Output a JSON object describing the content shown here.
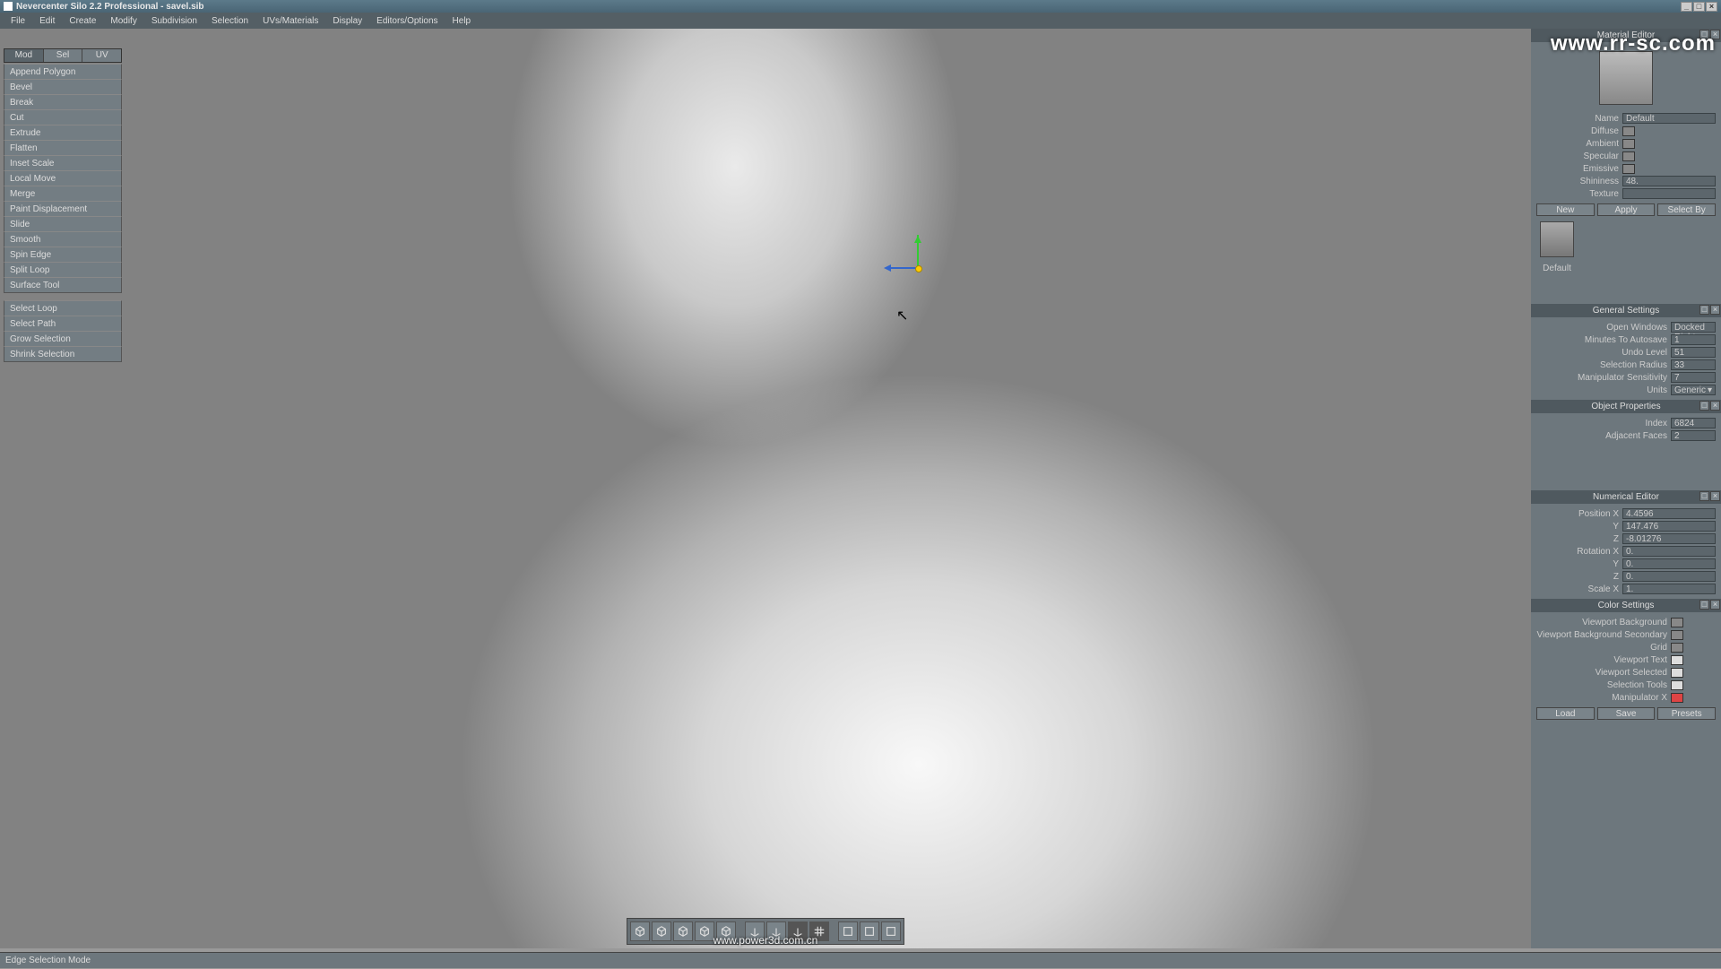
{
  "app": {
    "title": "Nevercenter Silo 2.2 Professional - savel.sib"
  },
  "menu": [
    "File",
    "Edit",
    "Create",
    "Modify",
    "Subdivision",
    "Selection",
    "UVs/Materials",
    "Display",
    "Editors/Options",
    "Help"
  ],
  "watermarkUrl": "www.rr-sc.com",
  "powerUrl": "www.power3d.com.cn",
  "segtabs": {
    "items": [
      "Mod",
      "Sel",
      "UV"
    ],
    "active": 0
  },
  "tools": {
    "groupA": [
      "Append Polygon",
      "Bevel",
      "Break",
      "Cut",
      "Extrude",
      "Flatten",
      "Inset Scale",
      "Local Move",
      "Merge",
      "Paint Displacement",
      "Slide",
      "Smooth",
      "Spin Edge",
      "Split Loop",
      "Surface Tool"
    ],
    "groupB": [
      "Select Loop",
      "Select Path",
      "Grow Selection",
      "Shrink Selection"
    ]
  },
  "materialEditor": {
    "title": "Material Editor",
    "nameLabel": "Name",
    "nameVal": "Default",
    "diffuse": "Diffuse",
    "ambient": "Ambient",
    "specular": "Specular",
    "emissive": "Emissive",
    "shininessLabel": "Shininess",
    "shininessVal": "48.",
    "textureLabel": "Texture",
    "textureVal": "",
    "buttons": [
      "New",
      "Apply",
      "Select By"
    ],
    "thumbLabel": "Default"
  },
  "generalSettings": {
    "title": "General Settings",
    "rows": [
      {
        "lbl": "Open Windows",
        "val": "Docked Right",
        "select": true
      },
      {
        "lbl": "Minutes To Autosave",
        "val": "1"
      },
      {
        "lbl": "Undo Level",
        "val": "51"
      },
      {
        "lbl": "Selection Radius",
        "val": "33"
      },
      {
        "lbl": "Manipulator Sensitivity",
        "val": "7"
      },
      {
        "lbl": "Units",
        "val": "Generic",
        "select": true
      }
    ]
  },
  "objectProps": {
    "title": "Object Properties",
    "rows": [
      {
        "lbl": "Index",
        "val": "6824"
      },
      {
        "lbl": "Adjacent Faces",
        "val": "2"
      }
    ]
  },
  "numEditor": {
    "title": "Numerical Editor",
    "rows": [
      {
        "lbl": "Position X",
        "val": "4.4596"
      },
      {
        "lbl": "Y",
        "val": "147.476"
      },
      {
        "lbl": "Z",
        "val": "-8.01276"
      },
      {
        "lbl": "Rotation X",
        "val": "0."
      },
      {
        "lbl": "Y",
        "val": "0."
      },
      {
        "lbl": "Z",
        "val": "0."
      },
      {
        "lbl": "Scale X",
        "val": "1."
      }
    ]
  },
  "colorSettings": {
    "title": "Color Settings",
    "rows": [
      {
        "lbl": "Viewport Background",
        "cls": ""
      },
      {
        "lbl": "Viewport Background Secondary",
        "cls": ""
      },
      {
        "lbl": "Grid",
        "cls": ""
      },
      {
        "lbl": "Viewport Text",
        "cls": "swwht"
      },
      {
        "lbl": "Viewport Selected",
        "cls": "swwht"
      },
      {
        "lbl": "Selection Tools",
        "cls": "swwht"
      },
      {
        "lbl": "Manipulator X",
        "cls": "swred"
      }
    ],
    "buttons": [
      "Load",
      "Save",
      "Presets"
    ]
  },
  "status": "Edge Selection Mode",
  "bottomTools": [
    "cube-shaded",
    "cube-wire",
    "cube-uv",
    "cube-smooth",
    "cube-sub",
    "axis-x",
    "axis-y",
    "axis-z",
    "grid",
    "panel-1",
    "panel-2",
    "panel-3"
  ]
}
